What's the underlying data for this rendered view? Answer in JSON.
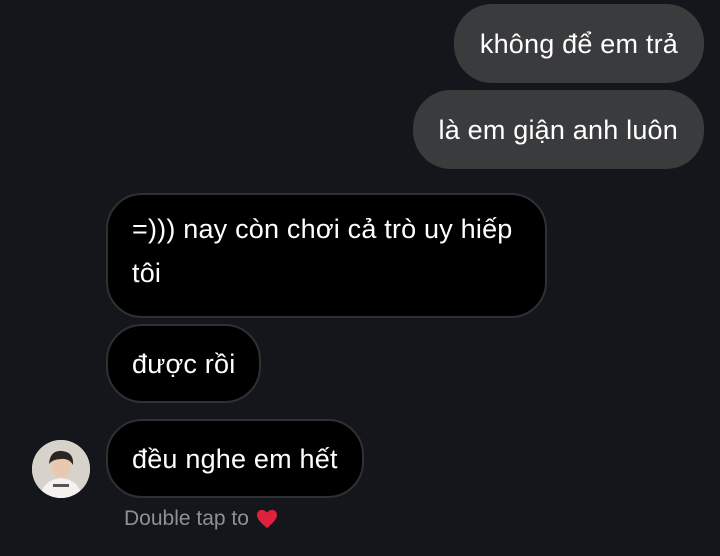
{
  "conversation": {
    "messages": [
      {
        "direction": "sent",
        "text": "không để em trả"
      },
      {
        "direction": "sent",
        "text": "là em giận anh luôn"
      },
      {
        "direction": "received",
        "text": "=))) nay còn chơi cả trò uy hiếp tôi"
      },
      {
        "direction": "received",
        "text": "được rồi"
      },
      {
        "direction": "received",
        "text": "đều nghe em hết"
      }
    ],
    "reaction_hint": "Double tap to",
    "reaction_icon": "heart-icon",
    "colors": {
      "background": "#14161b",
      "sent_bubble": "#3a3b3d",
      "received_bubble": "#000000",
      "heart": "#e0213b"
    }
  }
}
